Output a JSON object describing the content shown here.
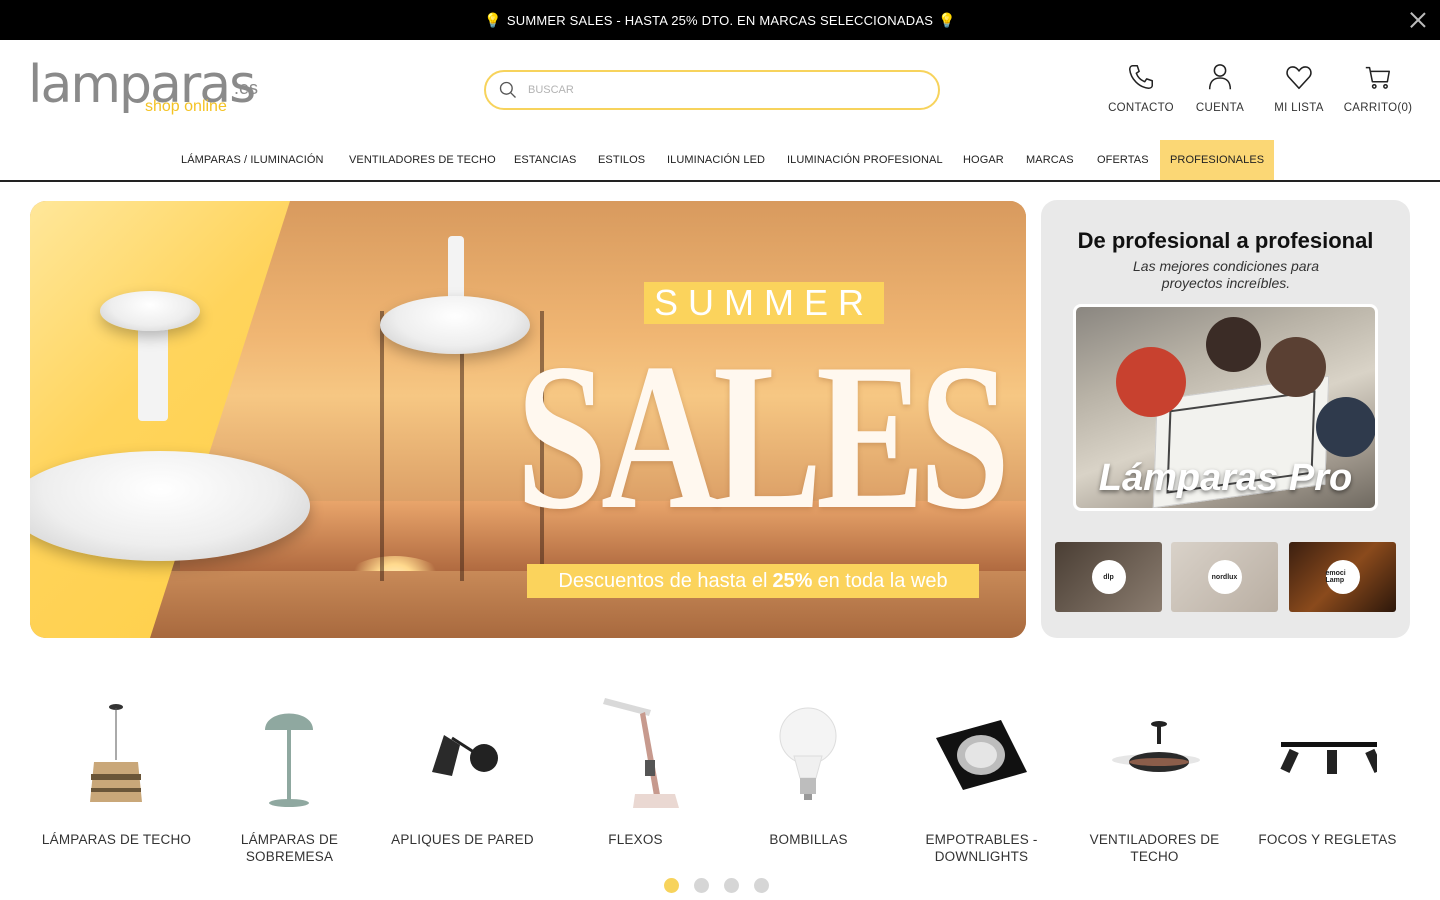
{
  "topbar": {
    "promo_text": "SUMMER SALES - HASTA 25% DTO. EN MARCAS SELECCIONADAS",
    "bulb_icon": "lightbulb-icon"
  },
  "logo": {
    "word": "lamparas",
    "tld": ".es",
    "tagline": "shop online"
  },
  "search": {
    "placeholder": "BUSCAR"
  },
  "header_actions": [
    {
      "label": "CONTACTO",
      "icon": "phone-icon"
    },
    {
      "label": "CUENTA",
      "icon": "user-icon"
    },
    {
      "label": "MI LISTA",
      "icon": "heart-icon"
    },
    {
      "label": "CARRITO(0)",
      "icon": "cart-icon"
    }
  ],
  "nav": [
    "LÁMPARAS / ILUMINACIÓN",
    "VENTILADORES DE TECHO",
    "ESTANCIAS",
    "ESTILOS",
    "ILUMINACIÓN LED",
    "ILUMINACIÓN PROFESIONAL",
    "HOGAR",
    "MARCAS",
    "OFERTAS",
    "PROFESIONALES"
  ],
  "hero": {
    "kicker": "SUMMER",
    "headline": "SALES",
    "discount_prefix": "Descuentos de hasta el",
    "discount_value": "25%",
    "discount_suffix": "en toda la web"
  },
  "pro_card": {
    "title": "De profesional a profesional",
    "subtitle": "Las mejores condiciones para proyectos increíbles.",
    "brand": "Lámparas Pro",
    "brands": [
      "dlp",
      "nordlux",
      "emoci Lamp"
    ]
  },
  "categories": [
    {
      "label": "LÁMPARAS DE TECHO"
    },
    {
      "label": "LÁMPARAS DE SOBREMESA"
    },
    {
      "label": "APLIQUES DE PARED"
    },
    {
      "label": "FLEXOS"
    },
    {
      "label": "BOMBILLAS"
    },
    {
      "label": "EMPOTRABLES - DOWNLIGHTS"
    },
    {
      "label": "VENTILADORES DE TECHO"
    },
    {
      "label": "FOCOS Y REGLETAS"
    }
  ],
  "carousel": {
    "pages": 4,
    "active_index": 0
  },
  "colors": {
    "accent": "#f7d35c",
    "topbar_bg": "#000000",
    "pro_bg": "#e9e9e9"
  }
}
